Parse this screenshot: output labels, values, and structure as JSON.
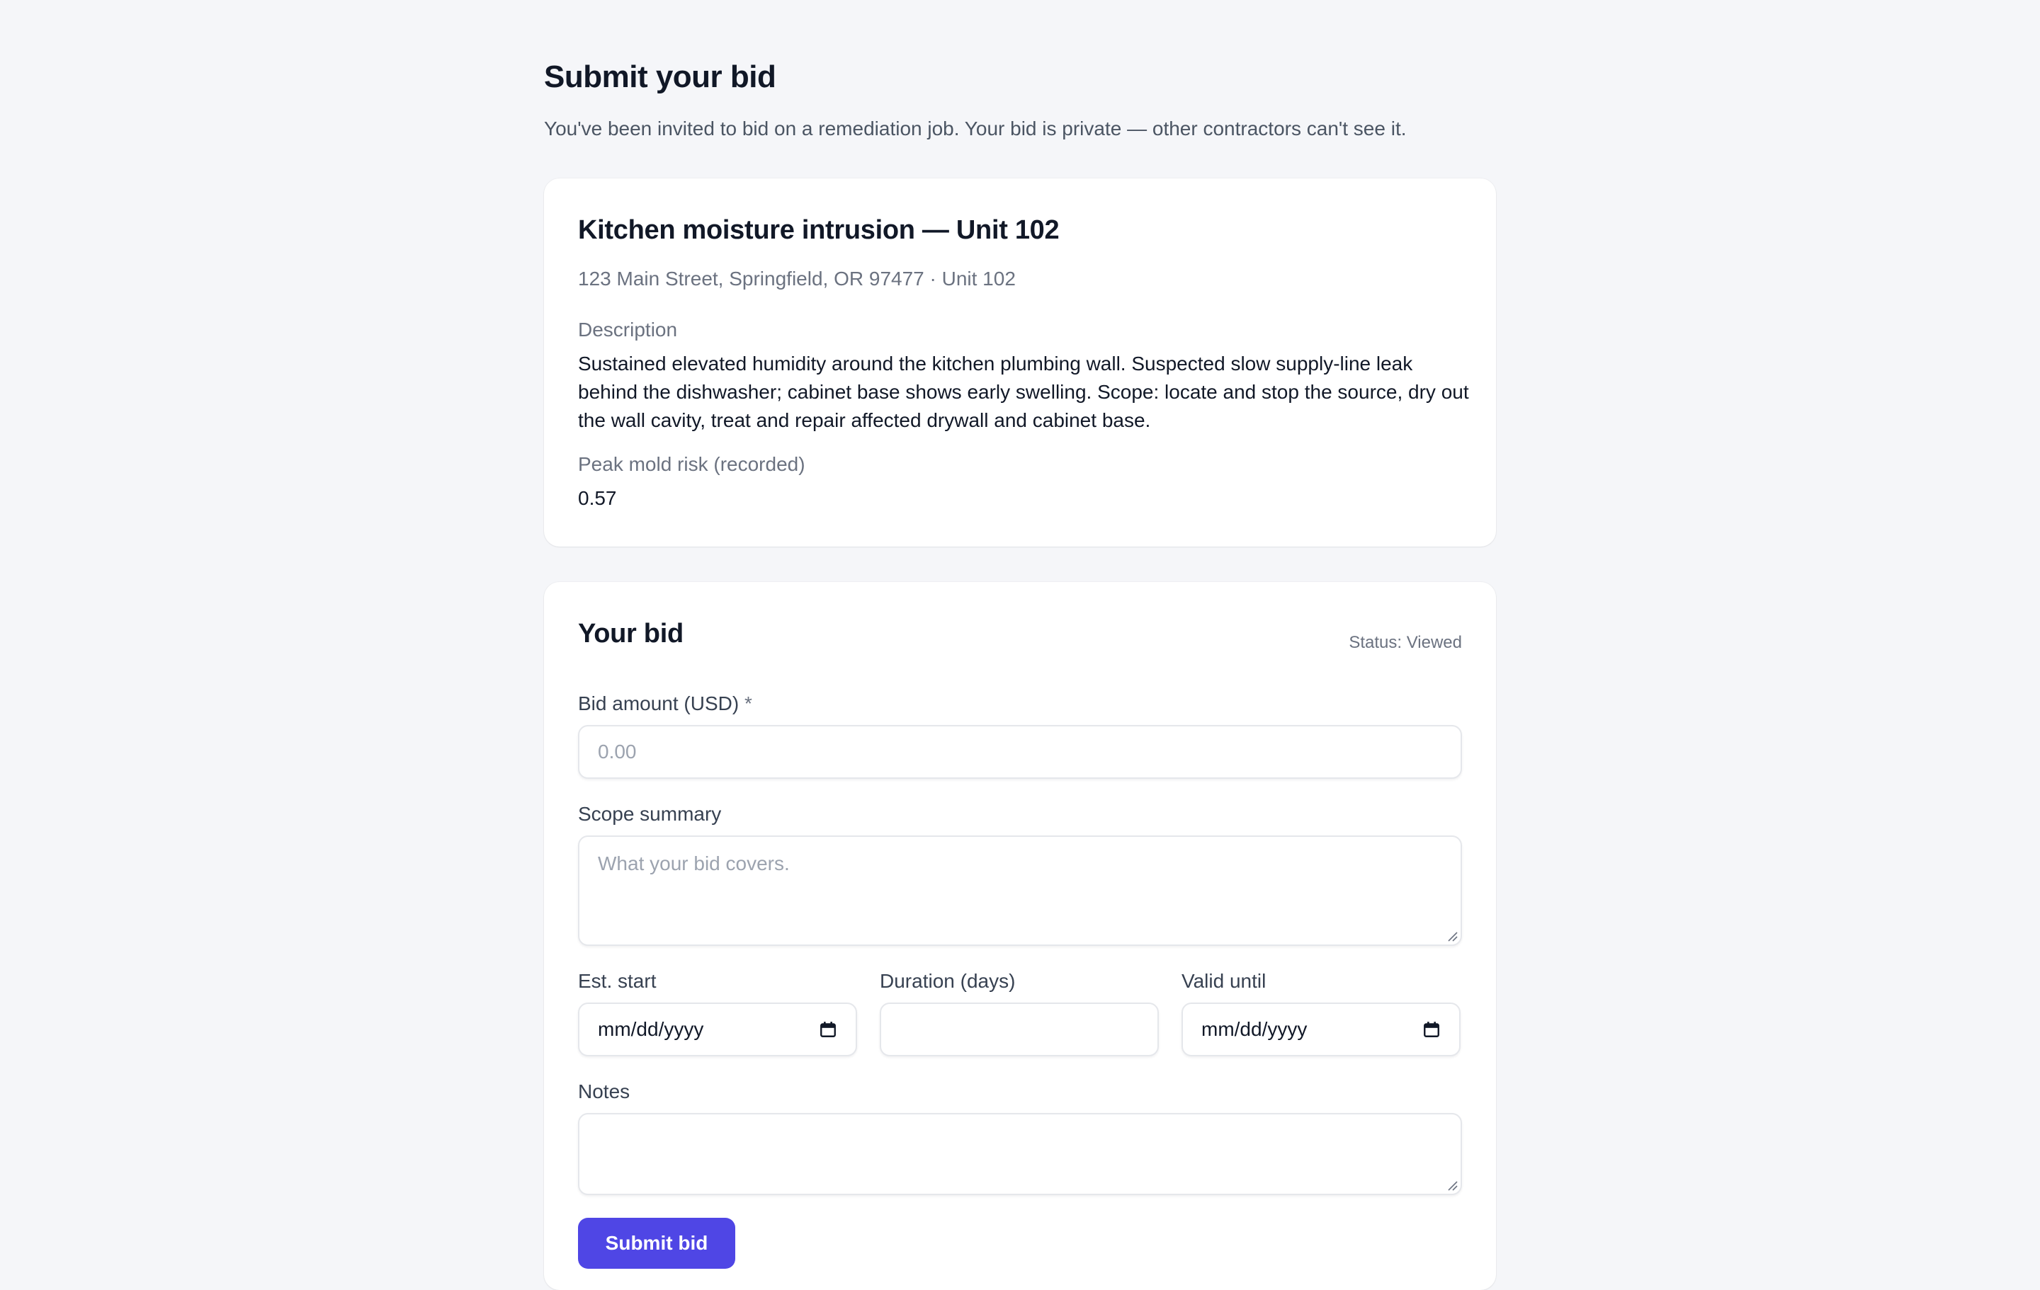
{
  "header": {
    "title": "Submit your bid",
    "subtitle": "You've been invited to bid on a remediation job. Your bid is private — other contractors can't see it."
  },
  "job": {
    "title": "Kitchen moisture intrusion — Unit 102",
    "address": "123 Main Street, Springfield, OR 97477 · Unit 102",
    "description_label": "Description",
    "description": "Sustained elevated humidity around the kitchen plumbing wall. Suspected slow supply-line leak behind the dishwasher; cabinet base shows early swelling. Scope: locate and stop the source, dry out the wall cavity, treat and repair affected drywall and cabinet base.",
    "risk_label": "Peak mold risk (recorded)",
    "risk_value": "0.57"
  },
  "bid": {
    "title": "Your bid",
    "status": "Status: Viewed",
    "amount_label": "Bid amount (USD)",
    "amount_required": "*",
    "amount_placeholder": "0.00",
    "scope_label": "Scope summary",
    "scope_placeholder": "What your bid covers.",
    "start_label": "Est. start",
    "start_value": "mm/dd/yyyy",
    "duration_label": "Duration (days)",
    "valid_label": "Valid until",
    "valid_value": "mm/dd/yyyy",
    "notes_label": "Notes",
    "submit_label": "Submit bid"
  },
  "icons": {
    "calendar": "calendar-icon",
    "resize": "resize-grip-icon"
  },
  "colors": {
    "accent": "#4f46e5",
    "background": "#f5f6f9",
    "card": "#ffffff"
  }
}
